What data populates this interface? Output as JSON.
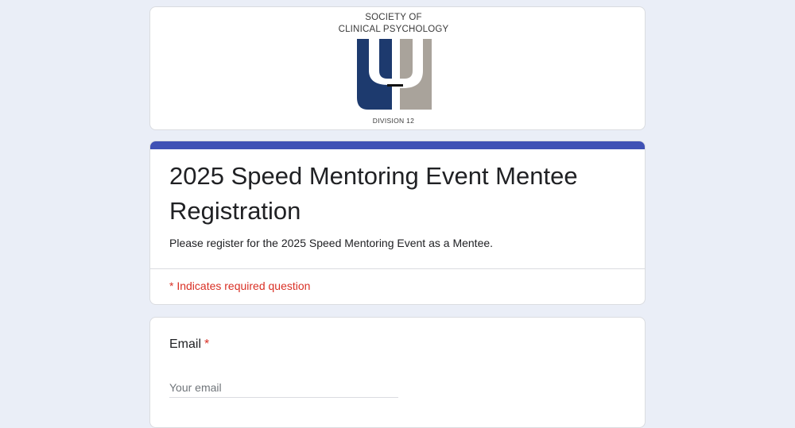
{
  "header": {
    "logo_line1": "SOCIETY OF",
    "logo_line2": "CLINICAL PSYCHOLOGY",
    "logo_line3": "DIVISION 12",
    "logo_colors": {
      "left": "#1d3a6e",
      "right": "#a9a39b"
    }
  },
  "form": {
    "accent_color": "#3f51b5",
    "title": "2025 Speed Mentoring Event Mentee Registration",
    "description": "Please register for the 2025 Speed Mentoring Event as a Mentee.",
    "required_note": "* Indicates required question"
  },
  "questions": [
    {
      "label": "Email",
      "required_marker": "*",
      "placeholder": "Your email",
      "value": ""
    }
  ]
}
